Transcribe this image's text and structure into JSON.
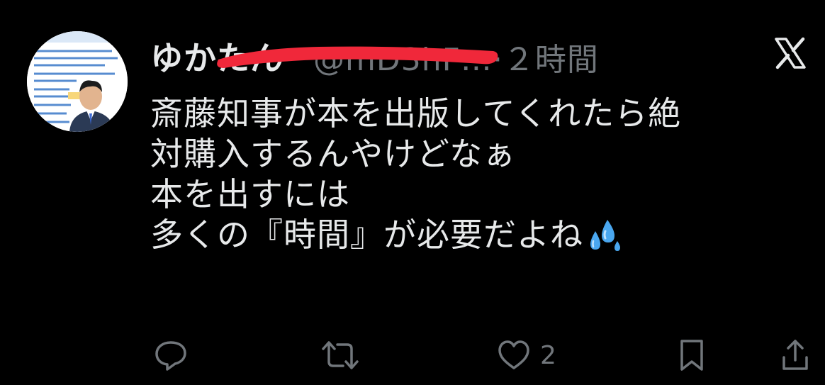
{
  "tweet": {
    "display_name": "ゆかたん",
    "handle": "@mD3hF…",
    "separator": "·",
    "time": "２時間",
    "text_lines": [
      "斎藤知事が本を出版してくれたら絶",
      "対購入するんやけどなぁ",
      "本を出すには",
      "多くの『時間』が必要だよね"
    ],
    "emoji": "sweat-droplets",
    "like_count": "2"
  },
  "icons": {
    "reply": "reply-icon",
    "retweet": "retweet-icon",
    "like": "like-icon",
    "bookmark": "bookmark-icon",
    "share": "share-icon",
    "platform": "x-logo"
  },
  "colors": {
    "background": "#000000",
    "text": "#e7e9ea",
    "secondary": "#71767b",
    "redaction": "#f0283a"
  }
}
